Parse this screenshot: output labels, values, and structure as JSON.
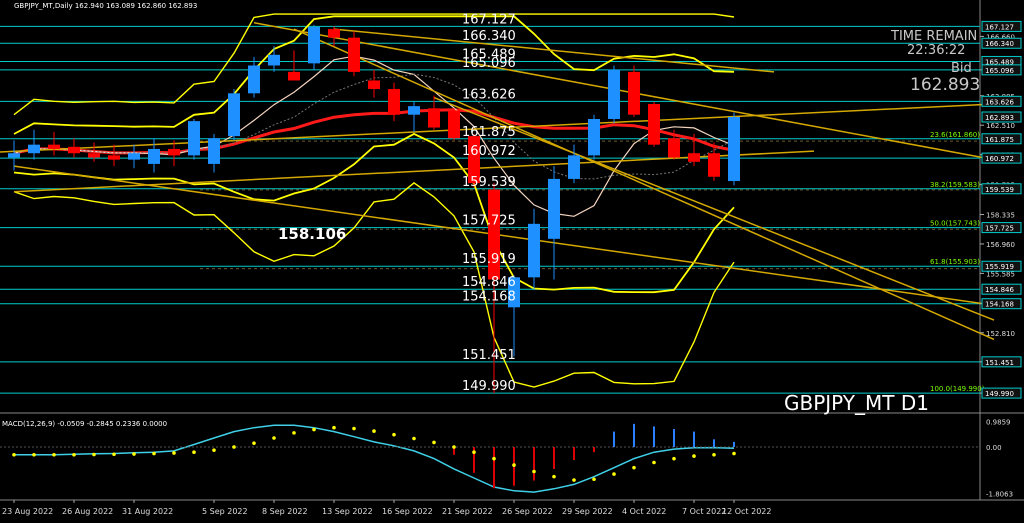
{
  "symbol_header": "GBPJPY_MT,Daily  162.940 163.089 162.860 162.893",
  "watermark": "GBPJPY_MT D1",
  "big_level_label": "158.106",
  "time_remain_label": "TIME REMAIN",
  "time_remain_value": "22:36:22",
  "bid_label": "Bid",
  "bid_value": "162.893",
  "macd_header": "MACD(12,26,9) -0.0509 -0.2845 0.2336 0.0000",
  "colors": {
    "bull": "#1e90ff",
    "bear": "#ff0000",
    "ma": "#ff1a1a",
    "bands": "#ffff00",
    "trend": "#d4a800",
    "levels": "#00cccc",
    "fib": "#7cfc00",
    "macd_signal": "#3fd0e8",
    "macd_dots": "#ffff00"
  },
  "chart_data": {
    "type": "candlestick",
    "title": "GBPJPY_MT D1",
    "x_labels": [
      "23 Aug 2022",
      "26 Aug 2022",
      "31 Aug 2022",
      "5 Sep 2022",
      "8 Sep 2022",
      "13 Sep 2022",
      "16 Sep 2022",
      "21 Sep 2022",
      "26 Sep 2022",
      "29 Sep 2022",
      "4 Oct 2022",
      "7 Oct 2022",
      "12 Oct 2022"
    ],
    "candles": [
      {
        "o": 161.0,
        "h": 161.8,
        "l": 160.4,
        "c": 161.2
      },
      {
        "o": 161.2,
        "h": 162.3,
        "l": 160.9,
        "c": 161.6
      },
      {
        "o": 161.6,
        "h": 162.2,
        "l": 161.1,
        "c": 161.4
      },
      {
        "o": 161.5,
        "h": 161.9,
        "l": 161.0,
        "c": 161.2
      },
      {
        "o": 161.2,
        "h": 161.7,
        "l": 160.8,
        "c": 161.0
      },
      {
        "o": 161.1,
        "h": 161.6,
        "l": 160.6,
        "c": 160.9
      },
      {
        "o": 160.9,
        "h": 161.6,
        "l": 160.5,
        "c": 161.2
      },
      {
        "o": 160.7,
        "h": 161.9,
        "l": 160.3,
        "c": 161.4
      },
      {
        "o": 161.4,
        "h": 161.8,
        "l": 160.6,
        "c": 161.1
      },
      {
        "o": 161.1,
        "h": 162.8,
        "l": 160.9,
        "c": 162.7
      },
      {
        "o": 160.7,
        "h": 162.1,
        "l": 160.3,
        "c": 161.9
      },
      {
        "o": 162.0,
        "h": 164.2,
        "l": 161.8,
        "c": 164.0
      },
      {
        "o": 164.0,
        "h": 165.7,
        "l": 163.8,
        "c": 165.3
      },
      {
        "o": 165.3,
        "h": 166.2,
        "l": 165.0,
        "c": 165.8
      },
      {
        "o": 165.0,
        "h": 166.0,
        "l": 164.6,
        "c": 164.6
      },
      {
        "o": 165.4,
        "h": 167.2,
        "l": 165.1,
        "c": 167.1
      },
      {
        "o": 167.0,
        "h": 167.127,
        "l": 166.2,
        "c": 166.6
      },
      {
        "o": 166.6,
        "h": 166.9,
        "l": 164.8,
        "c": 165.0
      },
      {
        "o": 164.6,
        "h": 165.1,
        "l": 163.8,
        "c": 164.2
      },
      {
        "o": 164.2,
        "h": 164.5,
        "l": 162.7,
        "c": 163.0
      },
      {
        "o": 163.0,
        "h": 163.6,
        "l": 162.2,
        "c": 163.4
      },
      {
        "o": 163.3,
        "h": 163.9,
        "l": 162.3,
        "c": 162.4
      },
      {
        "o": 163.2,
        "h": 163.3,
        "l": 161.8,
        "c": 161.9
      },
      {
        "o": 162.0,
        "h": 162.1,
        "l": 159.6,
        "c": 159.8
      },
      {
        "o": 159.5,
        "h": 159.8,
        "l": 149.99,
        "c": 155.3
      },
      {
        "o": 154.0,
        "h": 155.5,
        "l": 151.7,
        "c": 155.4
      },
      {
        "o": 155.4,
        "h": 158.6,
        "l": 154.8,
        "c": 157.9
      },
      {
        "o": 157.2,
        "h": 160.6,
        "l": 155.3,
        "c": 160.0
      },
      {
        "o": 160.0,
        "h": 161.6,
        "l": 159.8,
        "c": 161.1
      },
      {
        "o": 161.1,
        "h": 163.0,
        "l": 160.9,
        "c": 162.8
      },
      {
        "o": 162.8,
        "h": 165.3,
        "l": 162.6,
        "c": 165.1
      },
      {
        "o": 165.0,
        "h": 165.3,
        "l": 162.9,
        "c": 163.0
      },
      {
        "o": 163.5,
        "h": 163.6,
        "l": 161.5,
        "c": 161.6
      },
      {
        "o": 161.9,
        "h": 162.3,
        "l": 160.9,
        "c": 161.0
      },
      {
        "o": 161.2,
        "h": 162.1,
        "l": 160.6,
        "c": 160.8
      },
      {
        "o": 161.2,
        "h": 161.7,
        "l": 159.9,
        "c": 160.1
      },
      {
        "o": 159.9,
        "h": 163.1,
        "l": 159.7,
        "c": 162.893
      }
    ],
    "hlines": [
      {
        "y": 167.127,
        "label": "167.127"
      },
      {
        "y": 166.34,
        "label": "166.340"
      },
      {
        "y": 165.489,
        "label": "165.489"
      },
      {
        "y": 165.096,
        "label": "165.096"
      },
      {
        "y": 163.626,
        "label": "163.626"
      },
      {
        "y": 161.875,
        "label": "161.875"
      },
      {
        "y": 160.972,
        "label": "160.972"
      },
      {
        "y": 159.539,
        "label": "159.539"
      },
      {
        "y": 157.725,
        "label": "157.725"
      },
      {
        "y": 155.919,
        "label": "155.919"
      },
      {
        "y": 154.846,
        "label": "154.846"
      },
      {
        "y": 154.168,
        "label": "154.168"
      },
      {
        "y": 151.451,
        "label": "151.451"
      },
      {
        "y": 149.99,
        "label": "149.990"
      }
    ],
    "fib_labels": [
      {
        "y": 161.875,
        "label": "23.6(161.860)"
      },
      {
        "y": 159.539,
        "label": "38.2(159.583)"
      },
      {
        "y": 157.725,
        "label": "50.0(157.743)"
      },
      {
        "y": 155.919,
        "label": "61.8(155.903)"
      },
      {
        "y": 149.99,
        "label": "100.0(149.990)"
      }
    ],
    "y_ticks": [
      "166.660",
      "165.096",
      "163.885",
      "162.510",
      "161.135",
      "159.735",
      "158.335",
      "156.960",
      "155.585",
      "154.168",
      "152.810",
      "151.451",
      "149.990"
    ],
    "y_tick_values": [
      166.66,
      165.096,
      163.885,
      162.51,
      161.135,
      159.735,
      158.335,
      156.96,
      155.585,
      154.168,
      152.81,
      151.451,
      149.99
    ],
    "price_tags": [
      {
        "y": 167.127,
        "label": "167.127"
      },
      {
        "y": 166.34,
        "label": "166.340"
      },
      {
        "y": 165.489,
        "label": "165.489"
      },
      {
        "y": 165.096,
        "label": "165.096"
      },
      {
        "y": 163.626,
        "label": "163.626"
      },
      {
        "y": 162.893,
        "label": "162.893"
      },
      {
        "y": 161.875,
        "label": "161.875"
      },
      {
        "y": 160.972,
        "label": "160.972"
      },
      {
        "y": 159.539,
        "label": "159.539"
      },
      {
        "y": 157.725,
        "label": "157.725"
      },
      {
        "y": 155.919,
        "label": "155.919"
      },
      {
        "y": 154.846,
        "label": "154.846"
      },
      {
        "y": 154.168,
        "label": "154.168"
      },
      {
        "y": 151.451,
        "label": "151.451"
      },
      {
        "y": 149.99,
        "label": "149.990"
      }
    ],
    "ylim": [
      149.2,
      167.8
    ],
    "macd": {
      "ylim": [
        -1.9,
        1.05
      ],
      "y_ticks": [
        "0.9859",
        "0.00",
        "-1.8063"
      ],
      "y_tick_values": [
        0.9859,
        0.0,
        -1.8063
      ],
      "histogram": [
        0.0,
        0.0,
        0.0,
        0.0,
        0.0,
        0.0,
        0.0,
        0.0,
        0.0,
        0.0,
        0.0,
        0.0,
        0.0,
        0.0,
        0.0,
        0.0,
        0.0,
        0.0,
        0.0,
        0.0,
        0.0,
        0.0,
        -0.3,
        -1.0,
        -1.6,
        -1.5,
        -1.3,
        -0.85,
        -0.5,
        -0.2,
        0.6,
        0.9,
        0.8,
        0.7,
        0.6,
        0.3,
        0.2
      ],
      "signal": [
        -0.3,
        -0.3,
        -0.3,
        -0.28,
        -0.26,
        -0.25,
        -0.22,
        -0.2,
        -0.15,
        0.1,
        0.35,
        0.6,
        0.75,
        0.85,
        0.85,
        0.75,
        0.6,
        0.4,
        0.2,
        0.05,
        -0.15,
        -0.45,
        -0.85,
        -1.2,
        -1.55,
        -1.7,
        -1.75,
        -1.62,
        -1.45,
        -1.15,
        -0.8,
        -0.45,
        -0.2,
        -0.08,
        -0.03,
        -0.02,
        -0.05
      ],
      "dots": [
        -0.3,
        -0.3,
        -0.3,
        -0.3,
        -0.29,
        -0.28,
        -0.27,
        -0.25,
        -0.23,
        -0.2,
        -0.12,
        0.0,
        0.15,
        0.35,
        0.55,
        0.68,
        0.75,
        0.72,
        0.62,
        0.48,
        0.33,
        0.18,
        0.0,
        -0.2,
        -0.45,
        -0.7,
        -0.95,
        -1.15,
        -1.28,
        -1.25,
        -1.05,
        -0.8,
        -0.6,
        -0.45,
        -0.35,
        -0.3,
        -0.25
      ]
    }
  }
}
